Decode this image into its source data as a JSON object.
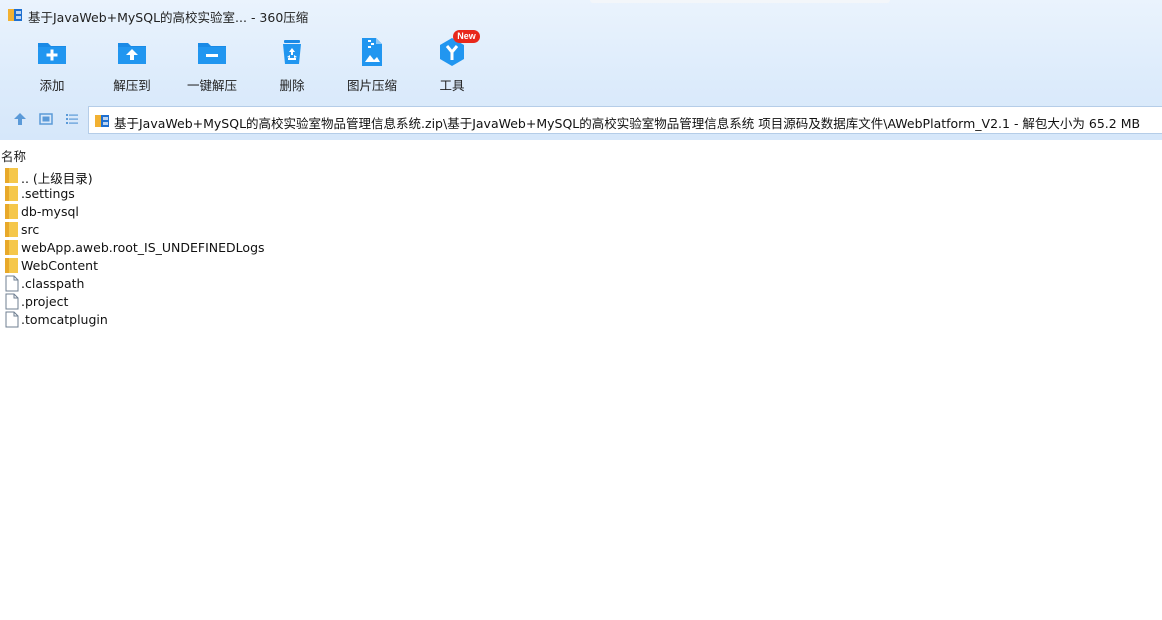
{
  "window": {
    "title": "基于JavaWeb+MySQL的高校实验室... - 360压缩",
    "app_icon": "archive-icon"
  },
  "toolbar": {
    "items": [
      {
        "label": "添加",
        "icon": "add-folder-icon"
      },
      {
        "label": "解压到",
        "icon": "extract-to-icon"
      },
      {
        "label": "一键解压",
        "icon": "one-click-extract-icon"
      },
      {
        "label": "删除",
        "icon": "recycle-icon"
      },
      {
        "label": "图片压缩",
        "icon": "image-compress-icon"
      },
      {
        "label": "工具",
        "icon": "tools-icon"
      }
    ],
    "new_badge": "New"
  },
  "navbar": {
    "up_icon": "up-arrow-icon",
    "view_icon": "thumbnail-view-icon",
    "list_icon": "list-view-icon",
    "path": "基于JavaWeb+MySQL的高校实验室物品管理信息系统.zip\\基于JavaWeb+MySQL的高校实验室物品管理信息系统 项目源码及数据库文件\\AWebPlatform_V2.1",
    "size_info": " - 解包大小为 65.2 MB"
  },
  "columns": {
    "name": "名称"
  },
  "files": [
    {
      "name": ".. (上级目录)",
      "type": "folder"
    },
    {
      "name": ".settings",
      "type": "folder"
    },
    {
      "name": "db-mysql",
      "type": "folder"
    },
    {
      "name": "src",
      "type": "folder"
    },
    {
      "name": "webApp.aweb.root_IS_UNDEFINEDLogs",
      "type": "folder"
    },
    {
      "name": "WebContent",
      "type": "folder"
    },
    {
      "name": ".classpath",
      "type": "file"
    },
    {
      "name": ".project",
      "type": "file"
    },
    {
      "name": ".tomcatplugin",
      "type": "file"
    }
  ],
  "colors": {
    "accent": "#1a8ae6",
    "folder": "#f5c74a",
    "badge": "#e8281c"
  }
}
